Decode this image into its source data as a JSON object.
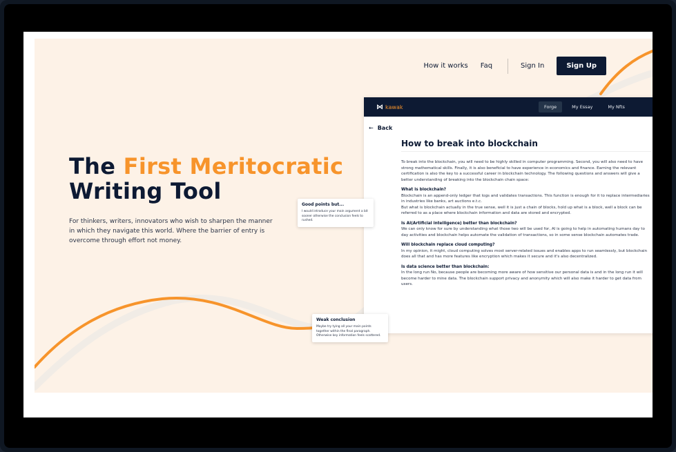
{
  "nav": {
    "links": [
      "How it works",
      "Faq"
    ],
    "sign_in": "Sign In",
    "sign_up": "Sign Up"
  },
  "hero": {
    "title_part1": "The ",
    "title_accent": "First Meritocratic",
    "title_part2": "Writing Tool",
    "subtitle": "For thinkers, writers, innovators who wish to sharpen the manner in which they navigate this world. Where the barrier of entry is overcome through effort not money."
  },
  "app": {
    "logo": "kawak",
    "tabs": [
      "Forge",
      "My Essay",
      "My Nfts"
    ],
    "active_tab": "Forge",
    "back": "Back",
    "doc_title": "How to break into blockchain",
    "intro": "To break into the blockchain, you will need to be highly skilled in computer programming. Second, you will also need to have strong mathematical skills. Finally, it is also beneficial to have experience in economics and finance. Earning the relevant certification is also the key to a successful career in blockchain technology. The following questions and answers will give a better understanding of breaking into the blockchain chain space:",
    "sections": [
      {
        "heading": "What is blockchain?",
        "body": "Blockchain is an append-only ledger that logs and validates transactions. This function is enough for it to replace intermediaries in industries like banks, art auctions e.t.c.\nBut what is blockchain actually in the true sense, well it is just a chain of blocks, hold up what is a block, well a block can be referred to as a place where blockchain information and data are stored and encrypted."
      },
      {
        "heading": "Is AI(Artificial intelligence) better than blockchain?",
        "body": "We can only know for sure by understanding what those two will be used for, AI is going to help in automating humans day to day activities and blockchain helps automate the validation of transactions,  so in some sense blockchain automates trade."
      },
      {
        "heading": "Will blockchain replace cloud computing?",
        "body": "In my opinion, it might, cloud computing solves most server-related issues and enables apps to run seamlessly, but blockchain does all that and has more features like encryption which makes it secure and it's also decentralized."
      },
      {
        "heading": "Is data science better than blockchain:",
        "body": "In the long run No, because people are becoming more aware of how sensitive our personal data is and in the long run it will become harder to mine data. The blockchain support privacy and anonymity which will also make it harder to get data from users."
      }
    ]
  },
  "cards": {
    "good": {
      "title": "Good points but...",
      "body": "I would introduce your main argument a bit sooner otherwise the conclusion feels to rushed."
    },
    "weak": {
      "title": "Weak conclusion",
      "body": "Maybe try tying all your main points together within the final paragraph. Otherwise key information feels scattered."
    }
  },
  "colors": {
    "accent": "#f7942b",
    "navy": "#0d1a33",
    "hero_bg": "#fdf2e7"
  }
}
